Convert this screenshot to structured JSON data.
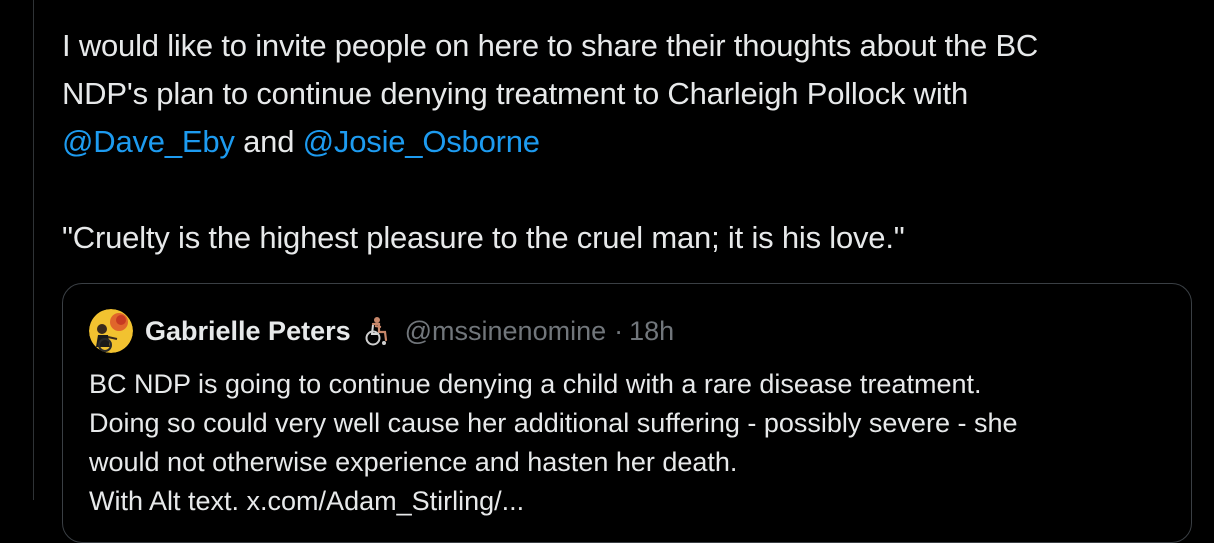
{
  "tweet": {
    "line1": "I would like to invite people on here to share their thoughts about the BC",
    "line2": "NDP's plan to continue denying treatment to Charleigh Pollock with",
    "mention1": "@Dave_Eby",
    "connector": " and ",
    "mention2": "@Josie_Osborne",
    "quote_line": "\"Cruelty is the highest pleasure to the cruel man; it is his love.\""
  },
  "quoted": {
    "author_name": "Gabrielle Peters",
    "handle": "@mssinenomine",
    "separator": "·",
    "time": "18h",
    "lines": [
      "BC NDP is going to continue denying a child with a rare disease treatment.",
      "Doing so could very well cause her additional suffering - possibly severe - she",
      "would not otherwise experience and hasten her death.",
      "With Alt text. x.com/Adam_Stirling/..."
    ]
  },
  "colors": {
    "background": "#000000",
    "text": "#e7e9ea",
    "link": "#1d9bf0",
    "muted": "#71767b",
    "border": "#3a3f44"
  },
  "icons": {
    "avatar": "avatar-icon",
    "name_emoji": "wheelchair-icon"
  }
}
